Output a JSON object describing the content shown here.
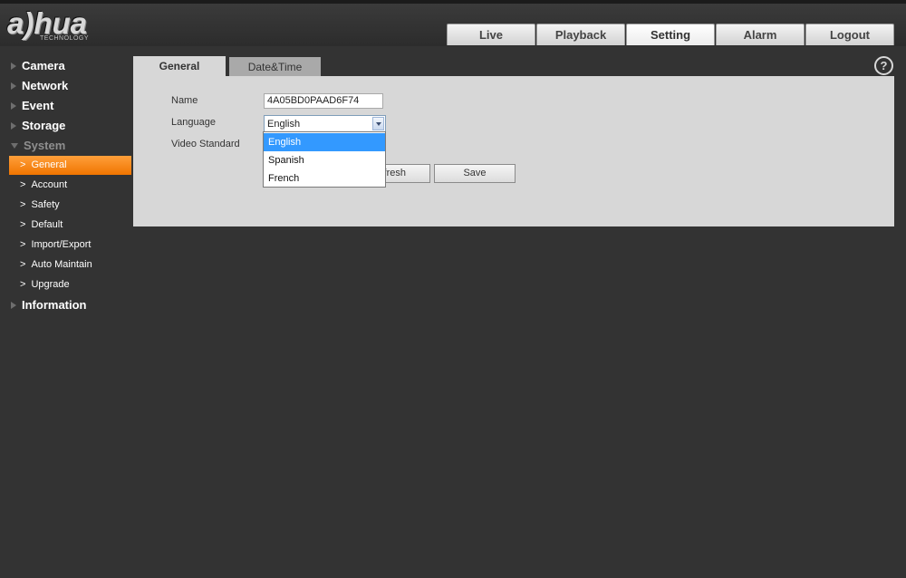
{
  "brand": {
    "logo_text": "a)hua",
    "logo_tagline": "TECHNOLOGY"
  },
  "top_nav": {
    "tabs": [
      {
        "label": "Live"
      },
      {
        "label": "Playback"
      },
      {
        "label": "Setting",
        "active": true
      },
      {
        "label": "Alarm"
      },
      {
        "label": "Logout"
      }
    ]
  },
  "sidebar": {
    "sections": {
      "camera": "Camera",
      "network": "Network",
      "event": "Event",
      "storage": "Storage",
      "system": "System",
      "information": "Information"
    },
    "system_items": [
      {
        "label": "General",
        "active": true
      },
      {
        "label": "Account"
      },
      {
        "label": "Safety"
      },
      {
        "label": "Default"
      },
      {
        "label": "Import/Export"
      },
      {
        "label": "Auto Maintain"
      },
      {
        "label": "Upgrade"
      }
    ]
  },
  "subtabs": {
    "general": "General",
    "datetime": "Date&Time"
  },
  "help_icon": "?",
  "form": {
    "name_label": "Name",
    "name_value": "4A05BD0PAAD6F74",
    "language_label": "Language",
    "language_value": "English",
    "video_standard_label": "Video Standard",
    "language_options": [
      "English",
      "Spanish",
      "French"
    ]
  },
  "buttons": {
    "refresh_visible": "fresh",
    "save": "Save"
  },
  "colors": {
    "accent": "#f07500",
    "selected_option": "#3399ff",
    "background": "#333333"
  }
}
